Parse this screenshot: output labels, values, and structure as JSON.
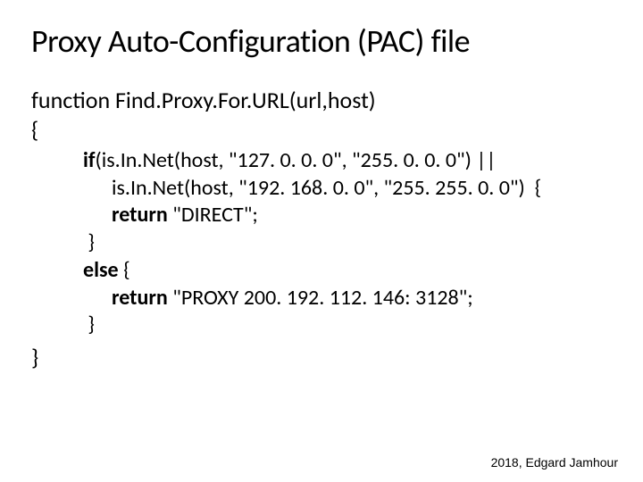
{
  "title": "Proxy Auto-Configuration (PAC) file",
  "func": {
    "line1": "function Find.Proxy.For.URL(url,host)",
    "openBrace": "{"
  },
  "code": {
    "l1a": "if",
    "l1b": "(is.In.Net(host, \"127. 0. 0. 0\", \"255. 0. 0. 0\") ||",
    "l2": "is.In.Net(host, \"192. 168. 0. 0\", \"255. 255. 0. 0\")  {",
    "l3a": "return ",
    "l3b": "\"DIRECT\"; ",
    "l4": " }",
    "l5a": "else ",
    "l5b": "{ ",
    "l6a": "return ",
    "l6b": "\"PROXY 200. 192. 112. 146: 3128\"; ",
    "l7": " }"
  },
  "closeBrace": "}",
  "footer": "2018, Edgard Jamhour"
}
